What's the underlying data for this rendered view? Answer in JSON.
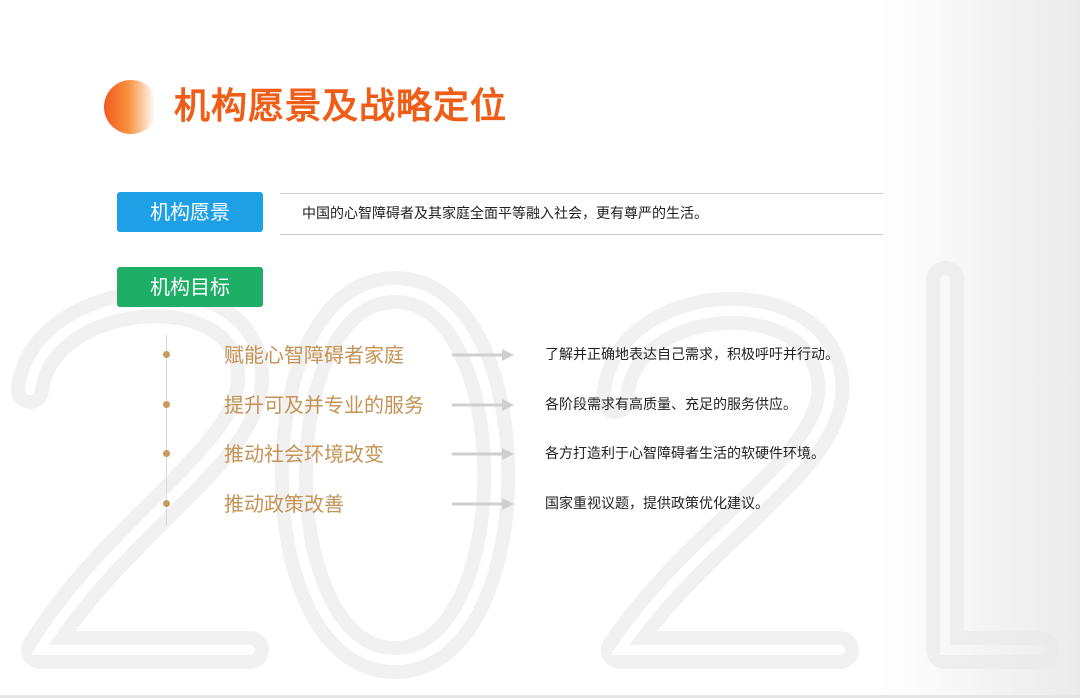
{
  "header": {
    "title": "机构愿景及战略定位"
  },
  "vision": {
    "label": "机构愿景",
    "text": "中国的心智障碍者及其家庭全面平等融入社会，更有尊严的生活。"
  },
  "goals": {
    "label": "机构目标",
    "items": [
      {
        "title": "赋能心智障碍者家庭",
        "desc": "了解并正确地表达自己需求，积极呼吁并行动。"
      },
      {
        "title": "提升可及并专业的服务",
        "desc": "各阶段需求有高质量、充足的服务供应。"
      },
      {
        "title": "推动社会环境改变",
        "desc": "各方打造利于心智障碍者生活的软硬件环境。"
      },
      {
        "title": "推动政策改善",
        "desc": "国家重视议题，提供政策优化建议。"
      }
    ]
  },
  "colors": {
    "title": "#ef5d17",
    "vision_button": "#1ea0e6",
    "goal_button": "#1fae65",
    "goal_text": "#c49355"
  },
  "icons": {
    "title_marker": "orange-gradient-circle-icon",
    "arrow": "arrow-right-icon",
    "bullet": "dot-icon"
  }
}
